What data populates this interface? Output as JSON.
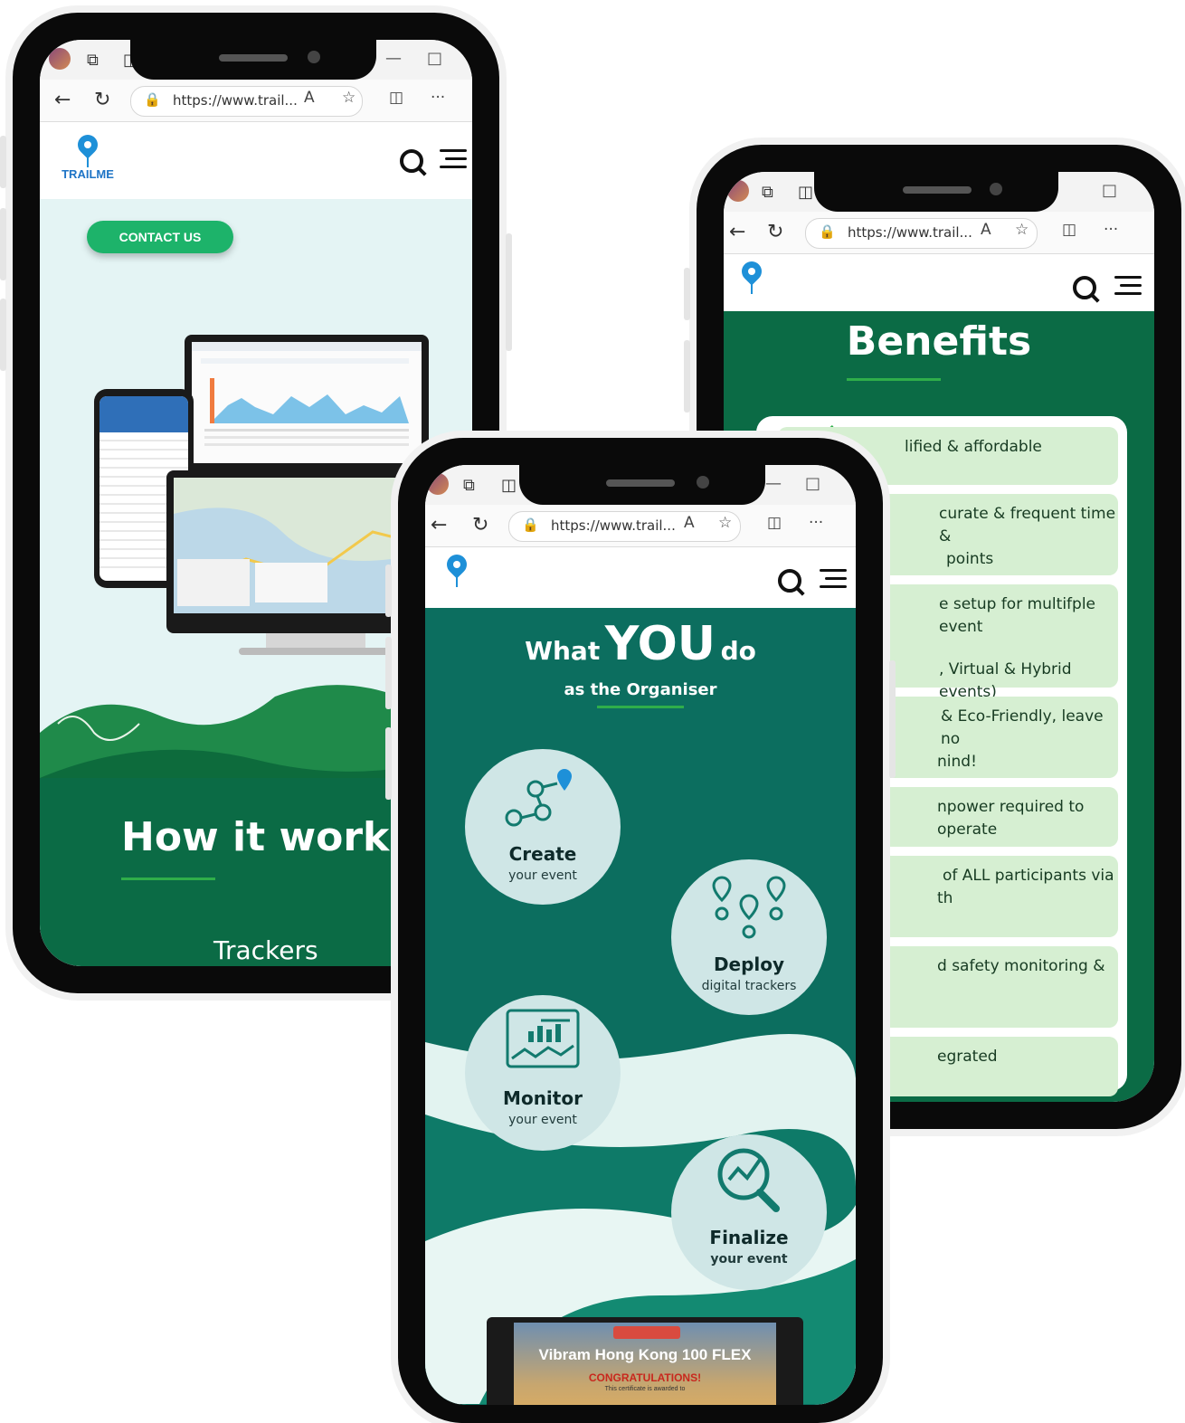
{
  "browser": {
    "url": "https://www.trail...",
    "read_aloud_label": "A",
    "more_label": "···"
  },
  "phone1": {
    "brand": "TRAILME",
    "contact_button": "CONTACT US",
    "section_title": "How it works",
    "section_subtitle": "Trackers"
  },
  "phone2": {
    "title_what": "What",
    "title_you": "YOU",
    "title_do": "do",
    "title_sub": "as the Organiser",
    "steps": [
      {
        "title": "Create",
        "sub": "your event",
        "icon": "nodes-route-icon"
      },
      {
        "title": "Deploy",
        "sub": "digital trackers",
        "icon": "location-pins-icon"
      },
      {
        "title": "Monitor",
        "sub": "your event",
        "icon": "dashboard-chart-icon"
      },
      {
        "title": "Finalize",
        "sub": "your event",
        "icon": "magnify-chart-icon"
      }
    ],
    "certificate": {
      "title": "Vibram Hong Kong 100 FLEX",
      "congrats": "CONGRATULATIONS!",
      "fineprint": "This certificate is awarded to"
    }
  },
  "phone3": {
    "title": "Benefits",
    "items": [
      {
        "line1": "lified & affordable",
        "line2": ""
      },
      {
        "line1": "curate & frequent time &",
        "line2": "points"
      },
      {
        "line1": "e setup for multifple event",
        "line2": ", Virtual & Hybrid events)"
      },
      {
        "line1": "& Eco-Friendly, leave no",
        "line2": "nind!"
      },
      {
        "line1": "npower required to operate",
        "line2": ""
      },
      {
        "line1": "of ALL participants via",
        "line2": "th"
      },
      {
        "line1": "d safety monitoring &",
        "line2": ""
      },
      {
        "line1": "egrated",
        "line2": ""
      }
    ]
  },
  "colors": {
    "dark_green": "#0b6b45",
    "teal": "#0c6e5f",
    "contact_green": "#1db36a",
    "benefit_card": "#d6efd2",
    "brand_blue": "#1e90d8"
  }
}
